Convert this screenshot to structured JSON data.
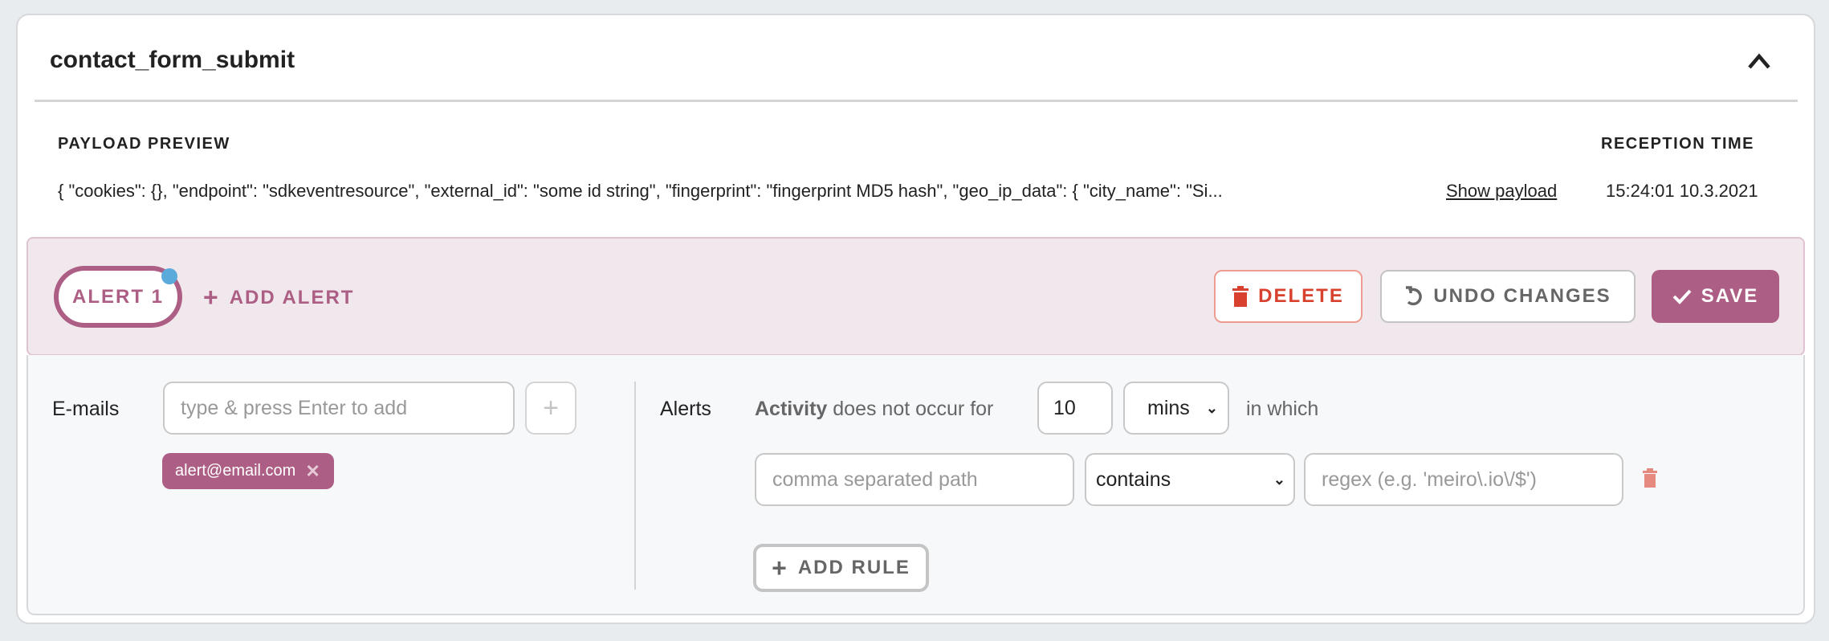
{
  "event": {
    "title": "contact_form_submit"
  },
  "preview": {
    "payload_header": "PAYLOAD PREVIEW",
    "time_header": "RECEPTION TIME",
    "payload_text": "{ \"cookies\": {}, \"endpoint\": \"sdkeventresource\", \"external_id\": \"some id string\", \"fingerprint\": \"fingerprint MD5 hash\", \"geo_ip_data\": { \"city_name\": \"Si...",
    "show_payload": "Show payload",
    "reception_time": "15:24:01 10.3.2021"
  },
  "alerts_bar": {
    "active_alert": "ALERT 1",
    "add_alert": "ADD ALERT",
    "delete": "DELETE",
    "undo": "UNDO CHANGES",
    "save": "SAVE"
  },
  "emails": {
    "label": "E-mails",
    "placeholder": "type & press Enter to add",
    "add_symbol": "+",
    "tags": [
      "alert@email.com"
    ]
  },
  "rules": {
    "label": "Alerts",
    "activity": "Activity",
    "condition_text": "does not occur for",
    "duration_value": "10",
    "duration_unit": "mins",
    "suffix": "in which",
    "path_placeholder": "comma separated path",
    "operator": "contains",
    "regex_placeholder": "regex (e.g. 'meiro\\.io\\/$')",
    "add_rule": "ADD RULE"
  },
  "colors": {
    "primary": "#ad5e84",
    "danger": "#d7412e",
    "indicator": "#5aabdc",
    "bar_bg": "#f0e8ed"
  }
}
